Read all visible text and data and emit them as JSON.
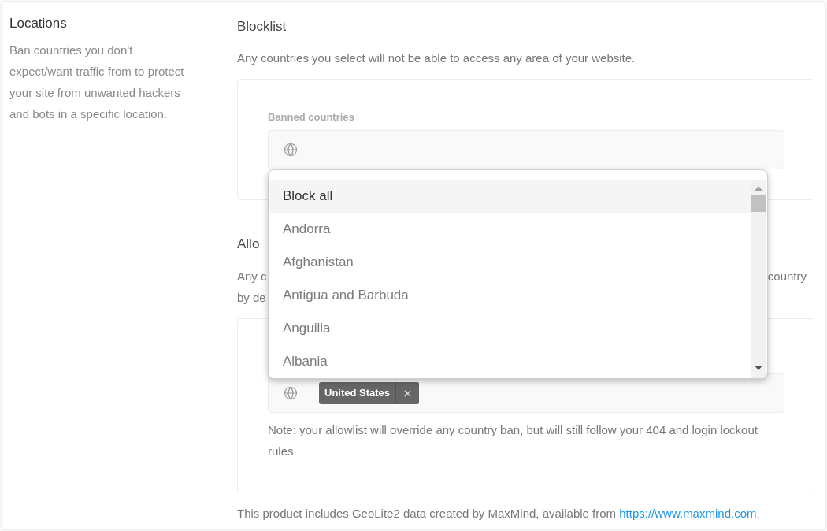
{
  "sidebar": {
    "title": "Locations",
    "description": "Ban countries you don't expect/want traffic from to protect your site from unwanted hackers and bots in a specific location."
  },
  "blocklist": {
    "title": "Blocklist",
    "description": "Any countries you select will not be able to access any area of your website.",
    "field": {
      "label": "Banned countries"
    },
    "dropdown": {
      "options": [
        {
          "label": "Block all",
          "selected": true
        },
        {
          "label": "Andorra",
          "selected": false
        },
        {
          "label": "Afghanistan",
          "selected": false
        },
        {
          "label": "Antigua and Barbuda",
          "selected": false
        },
        {
          "label": "Anguilla",
          "selected": false
        },
        {
          "label": "Albania",
          "selected": false
        }
      ]
    }
  },
  "allowlist": {
    "title": "Allo",
    "description_fragments": {
      "line_1_start": "Any c",
      "line_1_end": "country",
      "line_2_start": "by de"
    },
    "field": {
      "tags": [
        {
          "label": "United States"
        }
      ]
    },
    "note": "Note: your allowlist will override any country ban, but will still follow your 404 and login lockout rules."
  },
  "footer": {
    "text": "This product includes GeoLite2 data created by MaxMind, available from",
    "link": "https://www.maxmind.com",
    "text_after": "."
  }
}
